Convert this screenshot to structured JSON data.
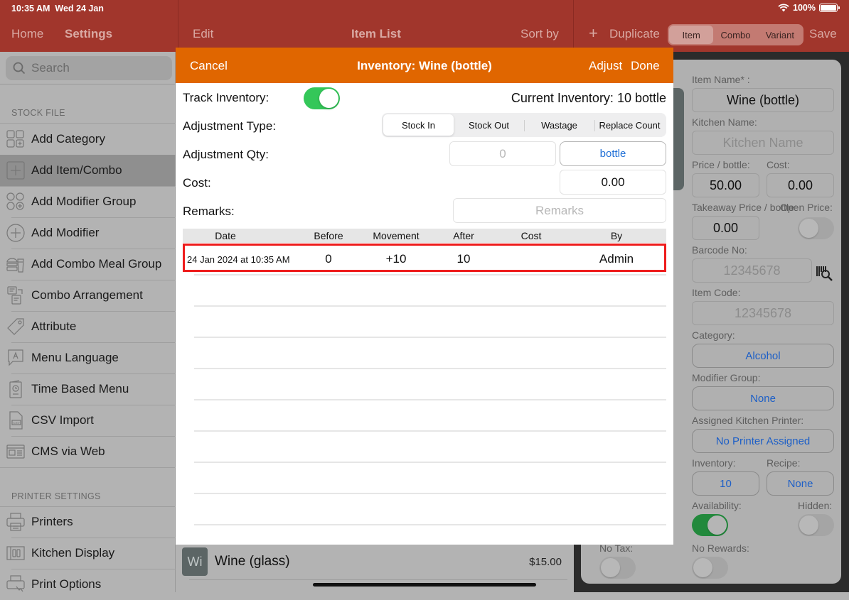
{
  "status_bar": {
    "time": "10:35 AM",
    "date": "Wed 24 Jan",
    "battery": "100%"
  },
  "nav": {
    "home": "Home",
    "settings": "Settings",
    "edit": "Edit",
    "item_list": "Item List",
    "sort_by": "Sort by",
    "plus": "+",
    "duplicate": "Duplicate",
    "type_segments": [
      "Item",
      "Combo",
      "Variant"
    ],
    "type_selected": "Item",
    "save": "Save"
  },
  "sidebar": {
    "search_placeholder": "Search",
    "section_stock": "STOCK FILE",
    "stock_items": [
      {
        "label": "Add Category",
        "icon": "category-grid-icon"
      },
      {
        "label": "Add Item/Combo",
        "icon": "add-square-icon",
        "selected": true
      },
      {
        "label": "Add Modifier Group",
        "icon": "modifier-group-icon"
      },
      {
        "label": "Add Modifier",
        "icon": "add-circle-icon"
      },
      {
        "label": "Add Combo Meal Group",
        "icon": "combo-meal-icon"
      },
      {
        "label": "Combo Arrangement",
        "icon": "arrangement-icon"
      },
      {
        "label": "Attribute",
        "icon": "tag-icon"
      },
      {
        "label": "Menu Language",
        "icon": "language-bubble-icon"
      },
      {
        "label": "Time Based Menu",
        "icon": "clock-menu-icon"
      },
      {
        "label": "CSV Import",
        "icon": "csv-file-icon"
      },
      {
        "label": "CMS via Web",
        "icon": "web-window-icon"
      }
    ],
    "section_printer": "PRINTER SETTINGS",
    "printer_items": [
      {
        "label": "Printers",
        "icon": "printer-icon"
      },
      {
        "label": "Kitchen Display",
        "icon": "kitchen-display-icon"
      },
      {
        "label": "Print Options",
        "icon": "print-options-icon"
      }
    ]
  },
  "item_list": {
    "rows": [
      {
        "badge": "Wi",
        "name": "Wine (glass)",
        "price": "$15.00"
      }
    ]
  },
  "item_form": {
    "item_name_label": "Item Name* :",
    "item_name": "Wine (bottle)",
    "kitchen_name_label": "Kitchen Name:",
    "kitchen_name_placeholder": "Kitchen Name",
    "price_label": "Price / bottle:",
    "price": "50.00",
    "cost_label": "Cost:",
    "cost": "0.00",
    "takeaway_label": "Takeaway Price / bottle:",
    "takeaway_price": "0.00",
    "open_price_label": "Open Price:",
    "open_price_on": false,
    "barcode_label": "Barcode No:",
    "barcode_placeholder": "12345678",
    "item_code_label": "Item Code:",
    "item_code_placeholder": "12345678",
    "category_label": "Category:",
    "category": "Alcohol",
    "modifier_group_label": "Modifier Group:",
    "modifier_group": "None",
    "kitchen_printer_label": "Assigned Kitchen Printer:",
    "kitchen_printer": "No Printer Assigned",
    "inventory_label": "Inventory:",
    "inventory": "10",
    "recipe_label": "Recipe:",
    "recipe": "None",
    "availability_label": "Availability:",
    "availability_on": true,
    "hidden_label": "Hidden:",
    "hidden_on": false,
    "no_tax_label": "No Tax:",
    "no_tax_on": false,
    "no_rewards_label": "No Rewards:",
    "no_rewards_on": false
  },
  "modal": {
    "cancel": "Cancel",
    "title": "Inventory: Wine (bottle)",
    "adjust": "Adjust",
    "done": "Done",
    "track_inventory_label": "Track Inventory:",
    "track_inventory_on": true,
    "current_inventory": "Current Inventory: 10 bottle",
    "adjustment_type_label": "Adjustment Type:",
    "adjustment_types": [
      "Stock In",
      "Stock Out",
      "Wastage",
      "Replace Count"
    ],
    "adjustment_type_selected": "Stock In",
    "adjustment_qty_label": "Adjustment Qty:",
    "adjustment_qty_placeholder": "0",
    "unit": "bottle",
    "cost_label": "Cost:",
    "cost_value": "0.00",
    "remarks_label": "Remarks:",
    "remarks_placeholder": "Remarks",
    "table": {
      "columns": [
        "Date",
        "Before",
        "Movement",
        "After",
        "Cost",
        "By"
      ],
      "rows": [
        {
          "date": "24 Jan 2024 at 10:35 AM",
          "before": "0",
          "movement": "+10",
          "after": "10",
          "cost": "",
          "by": "Admin"
        }
      ]
    }
  },
  "colors": {
    "nav_bar": "#a1362c",
    "modal_header": "#e06600",
    "toggle_on": "#34c759",
    "link_blue": "#1f6fd6",
    "highlight_red": "#ee1c1c"
  }
}
